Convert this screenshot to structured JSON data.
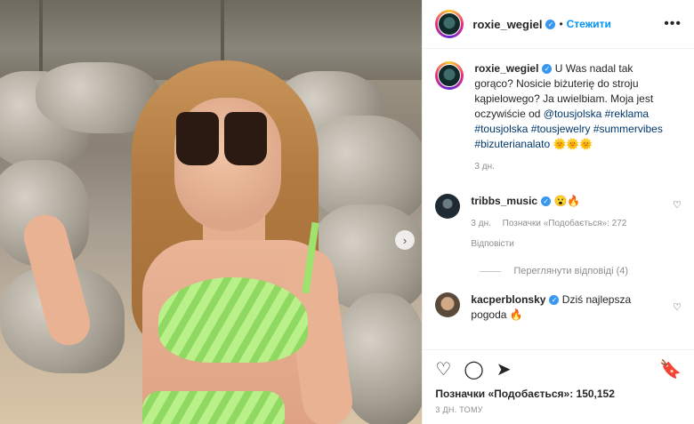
{
  "post": {
    "username": "roxie_wegiel",
    "follow_label": "Стежити",
    "more_label": "•••",
    "next_label": "›"
  },
  "caption": {
    "username": "roxie_wegiel",
    "text_1": "U Was nadal tak gorąco? Nosicie biżuterię do stroju kąpielowego? Ja uwielbiam. Moja jest oczywiście od",
    "link_mention": "@tousjolska",
    "link_tag1": "#reklama",
    "link_tag2": "#tousjolska",
    "link_tag3": "#tousjewelry",
    "link_tag4": "#summervibes",
    "link_tag5": "#bizuterianalato",
    "emoji": "🌞🌞🌞",
    "time": "3 дн."
  },
  "comments": [
    {
      "username": "tribbs_music",
      "text": "😮🔥",
      "time": "3 дн.",
      "likes": "Позначки «Подобається»: 272",
      "reply": "Відповісти",
      "view_replies": "Переглянути відповіді (4)"
    },
    {
      "username": "kacperblonsky",
      "text": "Dziś najlepsza pogoda 🔥"
    }
  ],
  "footer": {
    "likes": "Позначки «Подобається»: 150,152",
    "time": "3 ДН. ТОМУ"
  },
  "icons": {
    "heart": "♡",
    "comment": "◯",
    "share": "➤",
    "save": "🔖",
    "like_small": "♡"
  }
}
